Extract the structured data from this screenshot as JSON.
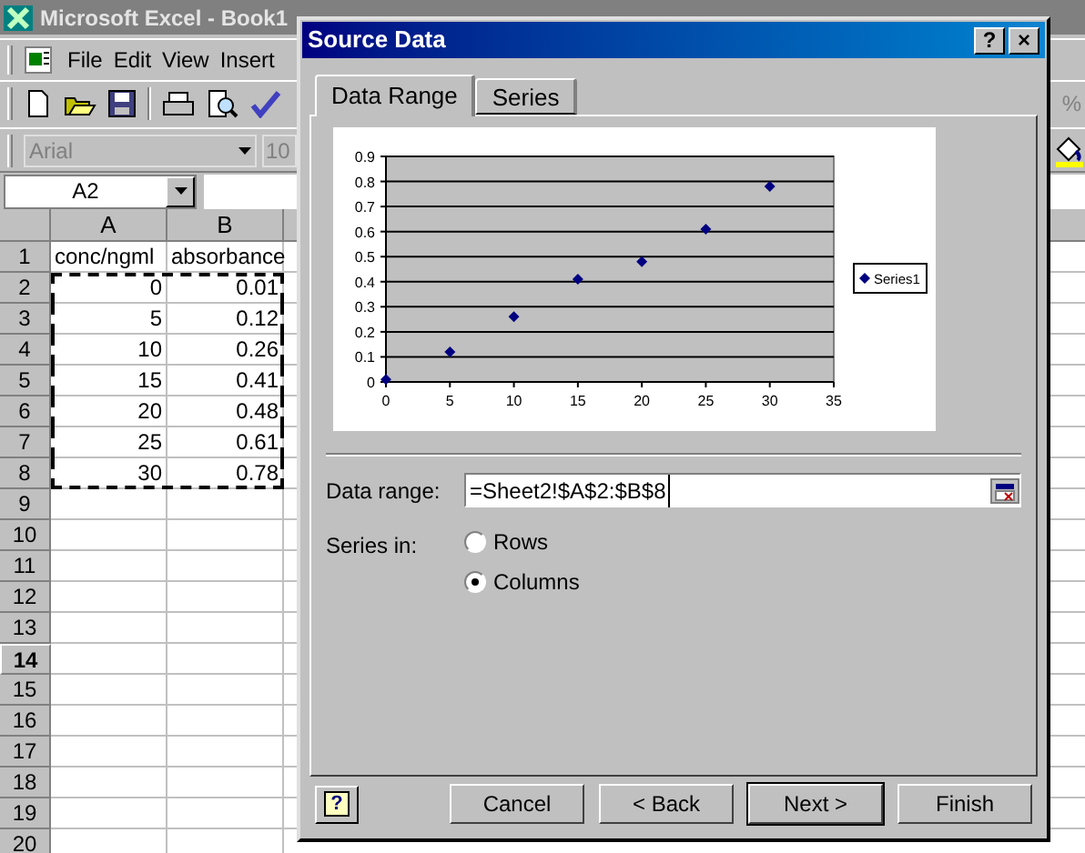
{
  "excel": {
    "title": "Microsoft Excel - Book1",
    "menu": [
      {
        "label": "File"
      },
      {
        "label": "Edit"
      },
      {
        "label": "View"
      },
      {
        "label": "Insert"
      }
    ],
    "zoom_fragment": "%",
    "font_box": {
      "value": "Arial"
    },
    "size_box": {
      "value": "10"
    },
    "name_box": {
      "value": "A2"
    },
    "columns": [
      "A",
      "B"
    ],
    "rows": [
      {
        "header": "1",
        "kind": "labels",
        "selected": false,
        "marked": false,
        "cells": [
          "conc/ngml",
          "absorbance"
        ]
      },
      {
        "header": "2",
        "kind": "numbers",
        "selected": false,
        "marked": true,
        "cells": [
          "0",
          "0.01"
        ]
      },
      {
        "header": "3",
        "kind": "numbers",
        "selected": false,
        "marked": true,
        "cells": [
          "5",
          "0.12"
        ]
      },
      {
        "header": "4",
        "kind": "numbers",
        "selected": false,
        "marked": true,
        "cells": [
          "10",
          "0.26"
        ]
      },
      {
        "header": "5",
        "kind": "numbers",
        "selected": false,
        "marked": true,
        "cells": [
          "15",
          "0.41"
        ]
      },
      {
        "header": "6",
        "kind": "numbers",
        "selected": false,
        "marked": true,
        "cells": [
          "20",
          "0.48"
        ]
      },
      {
        "header": "7",
        "kind": "numbers",
        "selected": false,
        "marked": true,
        "cells": [
          "25",
          "0.61"
        ]
      },
      {
        "header": "8",
        "kind": "numbers",
        "selected": false,
        "marked": true,
        "cells": [
          "30",
          "0.78"
        ]
      },
      {
        "header": "9",
        "selected": false,
        "marked": false
      },
      {
        "header": "10",
        "selected": false,
        "marked": false
      },
      {
        "header": "11",
        "selected": false,
        "marked": false
      },
      {
        "header": "12",
        "selected": false,
        "marked": false
      },
      {
        "header": "13",
        "selected": false,
        "marked": false
      },
      {
        "header": "14",
        "selected": true,
        "marked": false
      },
      {
        "header": "15",
        "selected": false,
        "marked": false
      },
      {
        "header": "16",
        "selected": false,
        "marked": false
      },
      {
        "header": "17",
        "selected": false,
        "marked": false
      },
      {
        "header": "18",
        "selected": false,
        "marked": false
      },
      {
        "header": "19",
        "selected": false,
        "marked": false
      },
      {
        "header": "20",
        "selected": false,
        "marked": false
      }
    ]
  },
  "dialog": {
    "title": "Source Data",
    "title_buttons": [
      "?",
      "×"
    ],
    "tabs": [
      {
        "label": "Data Range",
        "selected": true
      },
      {
        "label": "Series",
        "selected": false
      }
    ],
    "chart_data": {
      "type": "scatter",
      "x": [
        0,
        5,
        10,
        15,
        20,
        25,
        30
      ],
      "series": [
        {
          "name": "Series1",
          "color": "#000080",
          "values": [
            0.01,
            0.12,
            0.26,
            0.41,
            0.48,
            0.61,
            0.78
          ]
        }
      ],
      "xlim": [
        0,
        35
      ],
      "ylim": [
        0,
        0.9
      ],
      "xticks": [
        0,
        5,
        10,
        15,
        20,
        25,
        30,
        35
      ],
      "yticks": [
        0,
        0.1,
        0.2,
        0.3,
        0.4,
        0.5,
        0.6,
        0.7,
        0.8,
        0.9
      ],
      "grid": true
    },
    "data_range": {
      "label": "Data range:",
      "value": "=Sheet2!$A$2:$B$8"
    },
    "series_in": {
      "label": "Series in:",
      "options": [
        {
          "label": "Rows",
          "selected": false
        },
        {
          "label": "Columns",
          "selected": true
        }
      ]
    },
    "help_button": {
      "glyph": "?"
    },
    "buttons": [
      {
        "label": "Cancel",
        "default": false
      },
      {
        "label": "< Back",
        "default": false
      },
      {
        "label": "Next >",
        "default": true
      },
      {
        "label": "Finish",
        "default": false
      }
    ]
  }
}
